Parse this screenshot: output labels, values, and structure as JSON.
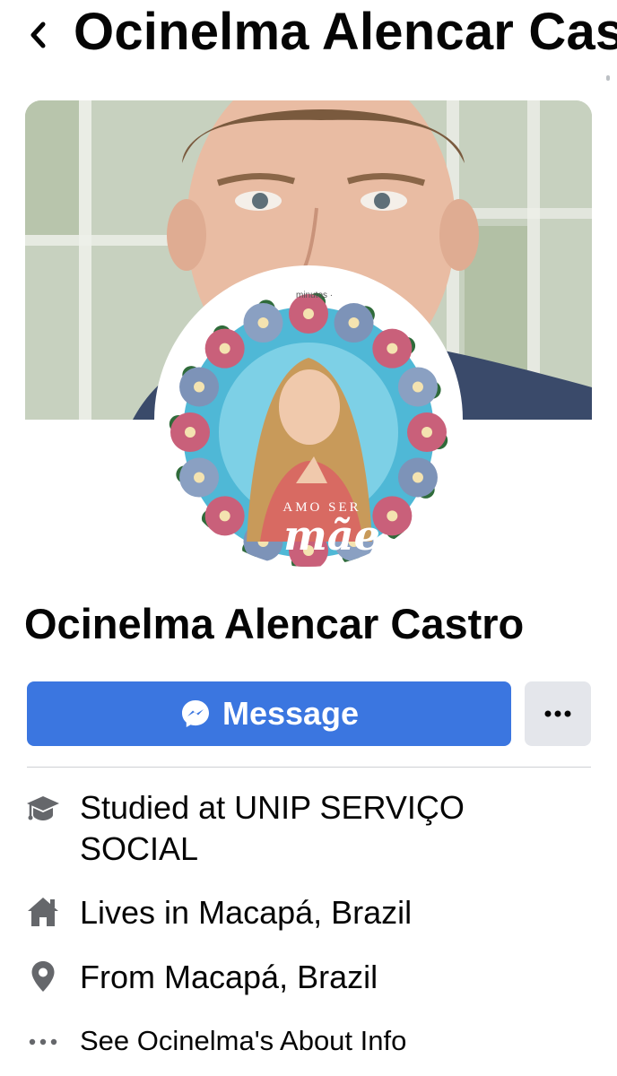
{
  "header": {
    "back_icon": "chevron-left-icon",
    "title": "Ocinelma Alencar Castro"
  },
  "profile": {
    "name": "Ocinelma Alencar Castro",
    "avatar_caption_top": "AMO SER",
    "avatar_caption_script": "mãe",
    "avatar_meta_text": "minutos · "
  },
  "actions": {
    "message_label": "Message",
    "message_icon": "messenger-icon",
    "more_icon": "more-horizontal-icon",
    "accent_color": "#3b76e0"
  },
  "info": [
    {
      "icon": "graduation-cap-icon",
      "prefix": "Studied at ",
      "value": "UNIP SERVIÇO SOCIAL"
    },
    {
      "icon": "home-icon",
      "prefix": "Lives in ",
      "value": "Macapá, Brazil"
    },
    {
      "icon": "location-pin-icon",
      "prefix": "From ",
      "value": "Macapá, Brazil"
    },
    {
      "icon": "more-dots-icon",
      "prefix": "",
      "value": "See Ocinelma's About Info"
    }
  ]
}
